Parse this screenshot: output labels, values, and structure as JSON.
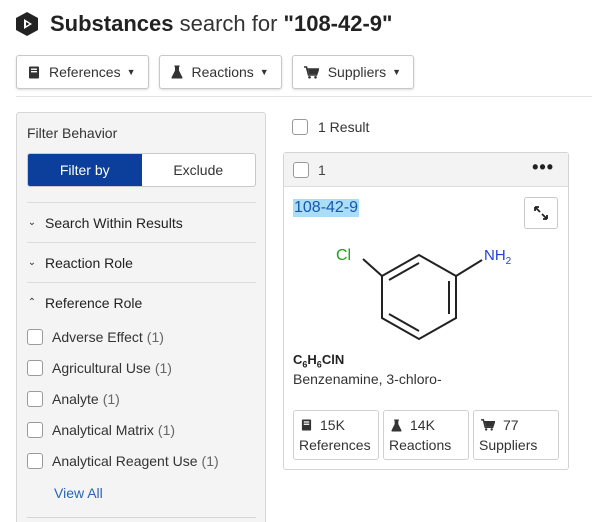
{
  "header": {
    "title_strong": "Substances",
    "title_mid": " search for ",
    "query": "\"108-42-9\"",
    "logo_icon": "cas-logo-icon"
  },
  "toolbar": {
    "buttons": [
      {
        "label": "References",
        "icon": "book-icon"
      },
      {
        "label": "Reactions",
        "icon": "flask-icon"
      },
      {
        "label": "Suppliers",
        "icon": "cart-icon"
      }
    ]
  },
  "filter": {
    "heading": "Filter Behavior",
    "filter_by": "Filter by",
    "exclude": "Exclude",
    "sections": [
      {
        "label": "Search Within Results",
        "state": "collapsed"
      },
      {
        "label": "Reaction Role",
        "state": "collapsed"
      },
      {
        "label": "Reference Role",
        "state": "expanded"
      }
    ],
    "options": [
      {
        "label": "Adverse Effect",
        "count": "(1)"
      },
      {
        "label": "Agricultural Use",
        "count": "(1)"
      },
      {
        "label": "Analyte",
        "count": "(1)"
      },
      {
        "label": "Analytical Matrix",
        "count": "(1)"
      },
      {
        "label": "Analytical Reagent Use",
        "count": "(1)"
      }
    ],
    "view_all": "View All"
  },
  "results": {
    "count_label": "1 Result",
    "card": {
      "index": "1",
      "menu": "•••",
      "cas": "108-42-9",
      "structure": {
        "cl": "Cl",
        "nh": "NH",
        "nh_sub": "2"
      },
      "formula": {
        "c": "C",
        "c_n": "6",
        "h": "H",
        "h_n": "6",
        "rest": "ClN"
      },
      "name": "Benzenamine, 3-chloro-",
      "stats": [
        {
          "value": "15K",
          "label": "References",
          "icon": "book-icon"
        },
        {
          "value": "14K",
          "label": "Reactions",
          "icon": "flask-icon"
        },
        {
          "value": "77",
          "label": "Suppliers",
          "icon": "cart-icon"
        }
      ]
    }
  },
  "colors": {
    "accent": "#0c3f9b",
    "link": "#2a64b5",
    "highlight": "#a9def6",
    "cl_green": "#1e9e1e",
    "n_blue": "#1f3fd6"
  }
}
